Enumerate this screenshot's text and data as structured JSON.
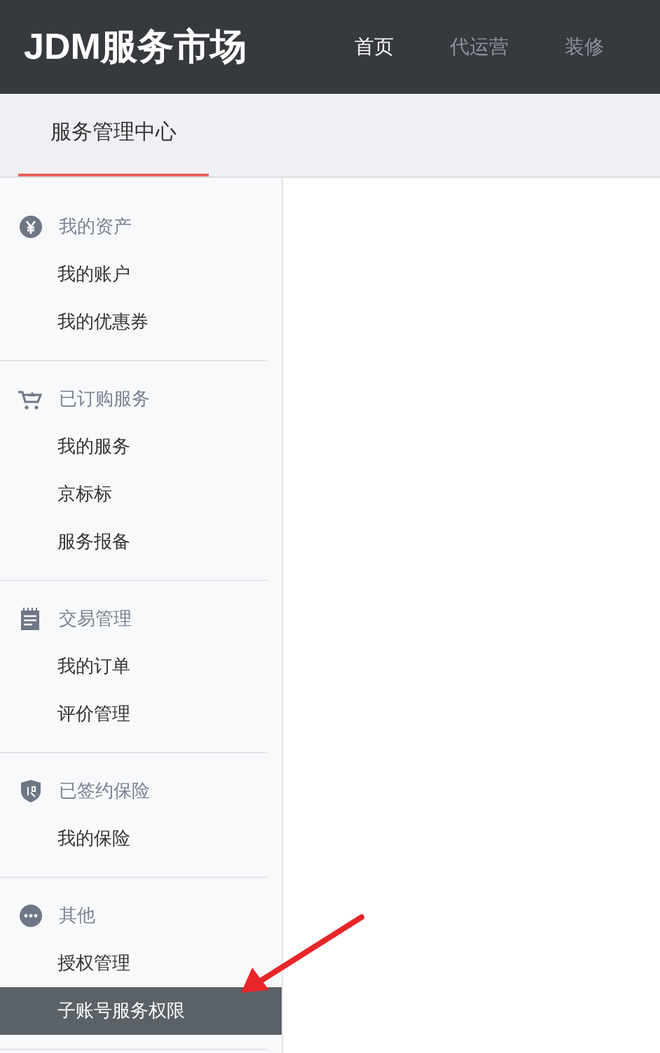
{
  "header": {
    "logo": "JDM服务市场",
    "nav": [
      {
        "label": "首页",
        "selected": true
      },
      {
        "label": "代运营",
        "selected": false
      },
      {
        "label": "装修",
        "selected": false
      }
    ]
  },
  "subnav": {
    "tabs": [
      {
        "label": "服务管理中心",
        "selected": true
      }
    ]
  },
  "sidebar": {
    "groups": [
      {
        "kind": "yen",
        "title": "我的资产",
        "items": [
          {
            "label": "我的账户",
            "selected": false
          },
          {
            "label": "我的优惠券",
            "selected": false
          }
        ]
      },
      {
        "kind": "cart",
        "title": "已订购服务",
        "items": [
          {
            "label": "我的服务",
            "selected": false
          },
          {
            "label": "京标标",
            "selected": false
          },
          {
            "label": "服务报备",
            "selected": false
          }
        ]
      },
      {
        "kind": "notepad",
        "title": "交易管理",
        "items": [
          {
            "label": "我的订单",
            "selected": false
          },
          {
            "label": "评价管理",
            "selected": false
          }
        ]
      },
      {
        "kind": "shield",
        "title": "已签约保险",
        "items": [
          {
            "label": "我的保险",
            "selected": false
          }
        ]
      },
      {
        "kind": "more",
        "title": "其他",
        "items": [
          {
            "label": "授权管理",
            "selected": false
          },
          {
            "label": "子账号服务权限",
            "selected": true
          }
        ]
      }
    ]
  }
}
